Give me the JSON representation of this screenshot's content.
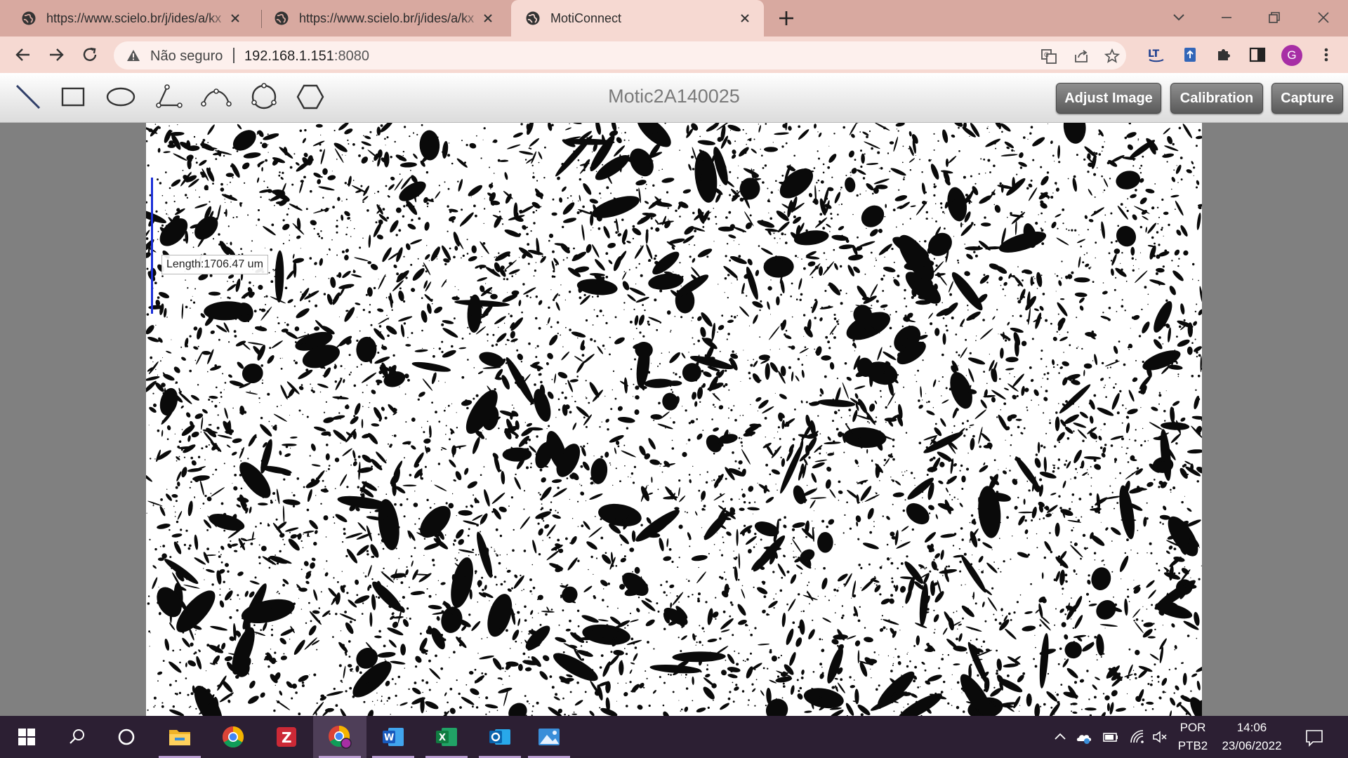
{
  "browser": {
    "tabs": [
      {
        "title": "https://www.scielo.br/j/ides/a/kx"
      },
      {
        "title": "https://www.scielo.br/j/ides/a/kx"
      },
      {
        "title": "MotiConnect"
      }
    ],
    "address": {
      "security_label": "Não seguro",
      "host": "192.168.1.151",
      "port": ":8080"
    },
    "profile_initial": "G",
    "accent": "#d8a9a0"
  },
  "app": {
    "title": "Motic2A140025",
    "tools": [
      "line-tool",
      "rectangle-tool",
      "ellipse-tool",
      "angle-tool",
      "arc-tool",
      "circle-tool",
      "polygon-tool"
    ],
    "buttons": {
      "adjust": "Adjust Image",
      "calibration": "Calibration",
      "capture": "Capture"
    },
    "measurement": {
      "label": "Length:1706.47 um",
      "color": "#1a2fd8"
    }
  },
  "taskbar": {
    "language": "POR",
    "layout": "PTB2",
    "time": "14:06",
    "date": "23/06/2022"
  }
}
